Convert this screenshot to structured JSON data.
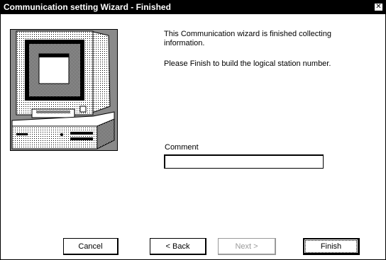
{
  "window": {
    "title": "Communication setting Wizard - Finished",
    "close_glyph": "✕"
  },
  "content": {
    "line1": "This Communication wizard is finished collecting information.",
    "line2": "Please Finish to build the logical station number."
  },
  "comment": {
    "label": "Comment",
    "value": ""
  },
  "buttons": {
    "cancel": "Cancel",
    "back": "< Back",
    "next": "Next >",
    "finish": "Finish"
  },
  "illustration": "computer-illustration",
  "colors": {
    "titlebar": "#000000",
    "background": "#ffffff",
    "disabled_text": "#9a9a9a"
  }
}
